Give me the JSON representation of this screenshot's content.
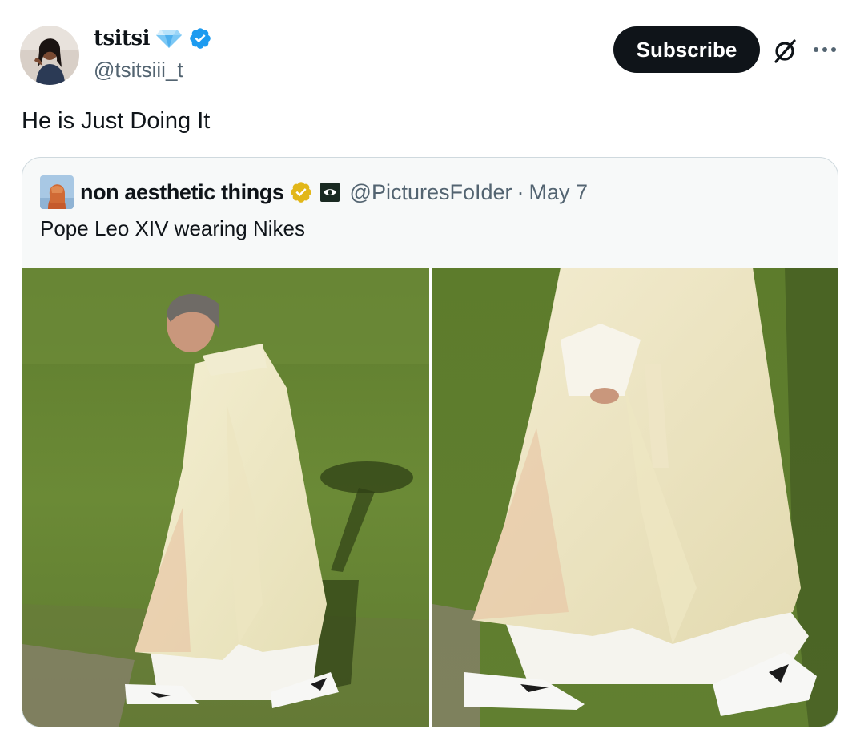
{
  "tweet": {
    "display_name": "tsitsi",
    "handle": "@tsitsiii_t",
    "text": "He is Just Doing It",
    "subscribe_label": "Subscribe",
    "icons": [
      "avatar",
      "diamond-icon",
      "verified-badge-icon",
      "grok-icon",
      "more-icon"
    ]
  },
  "quote": {
    "display_name": "non aesthetic things",
    "handle": "@PicturesFoIder",
    "separator": "·",
    "date": "May 7",
    "text": "Pope Leo XIV wearing Nikes",
    "icons": [
      "quote-avatar",
      "gold-verified-badge-icon",
      "affiliate-badge-icon"
    ]
  },
  "media": {
    "count": 2,
    "photos": [
      "photo-side-view",
      "photo-closeup-view"
    ]
  },
  "colors": {
    "text_primary": "#0f1419",
    "text_secondary": "#536471",
    "verified_blue": "#1d9bf0",
    "verified_gold": "#e2b719",
    "button_bg": "#0f1419",
    "card_bg": "#f7f9f9",
    "card_border": "#cfd9de"
  }
}
